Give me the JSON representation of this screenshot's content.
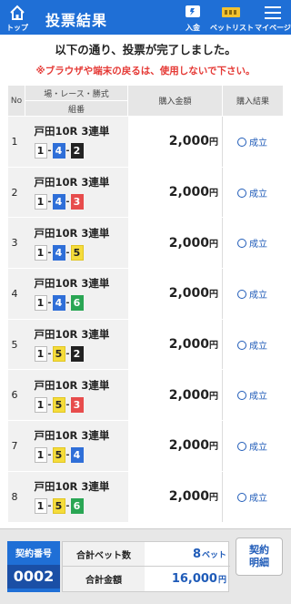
{
  "header": {
    "title": "投票結果",
    "top_label": "トップ",
    "deposit_label": "入金",
    "betlist_label": "ベットリスト",
    "mypage_label": "マイページ",
    "accent_color": "#1f6fd6"
  },
  "messages": {
    "completed": "以下の通り、投票が完了しました。",
    "warning": "※ブラウザや端末の戻るは、使用しないで下さい。"
  },
  "table": {
    "headers": {
      "no": "No",
      "place_race_type": "場・レース・勝式",
      "combination": "組番",
      "amount": "購入金額",
      "result": "購入結果"
    },
    "rows": [
      {
        "no": "1",
        "race": "戸田10R 3連単",
        "c1": "1",
        "c2": "4",
        "c3": "2",
        "amount": "2,000",
        "yen": "円",
        "result": "成立"
      },
      {
        "no": "2",
        "race": "戸田10R 3連単",
        "c1": "1",
        "c2": "4",
        "c3": "3",
        "amount": "2,000",
        "yen": "円",
        "result": "成立"
      },
      {
        "no": "3",
        "race": "戸田10R 3連単",
        "c1": "1",
        "c2": "4",
        "c3": "5",
        "amount": "2,000",
        "yen": "円",
        "result": "成立"
      },
      {
        "no": "4",
        "race": "戸田10R 3連単",
        "c1": "1",
        "c2": "4",
        "c3": "6",
        "amount": "2,000",
        "yen": "円",
        "result": "成立"
      },
      {
        "no": "5",
        "race": "戸田10R 3連単",
        "c1": "1",
        "c2": "5",
        "c3": "2",
        "amount": "2,000",
        "yen": "円",
        "result": "成立"
      },
      {
        "no": "6",
        "race": "戸田10R 3連単",
        "c1": "1",
        "c2": "5",
        "c3": "3",
        "amount": "2,000",
        "yen": "円",
        "result": "成立"
      },
      {
        "no": "7",
        "race": "戸田10R 3連単",
        "c1": "1",
        "c2": "5",
        "c3": "4",
        "amount": "2,000",
        "yen": "円",
        "result": "成立"
      },
      {
        "no": "8",
        "race": "戸田10R 3連単",
        "c1": "1",
        "c2": "5",
        "c3": "6",
        "amount": "2,000",
        "yen": "円",
        "result": "成立"
      }
    ]
  },
  "footer": {
    "contract_label": "契約番号",
    "contract_no": "0002",
    "total_bets_label": "合計ベット数",
    "total_bets": "8",
    "total_bets_unit": "ベット",
    "total_amount_label": "合計金額",
    "total_amount": "16,000",
    "total_amount_unit": "円",
    "detail_button_line1": "契約",
    "detail_button_line2": "明細"
  }
}
